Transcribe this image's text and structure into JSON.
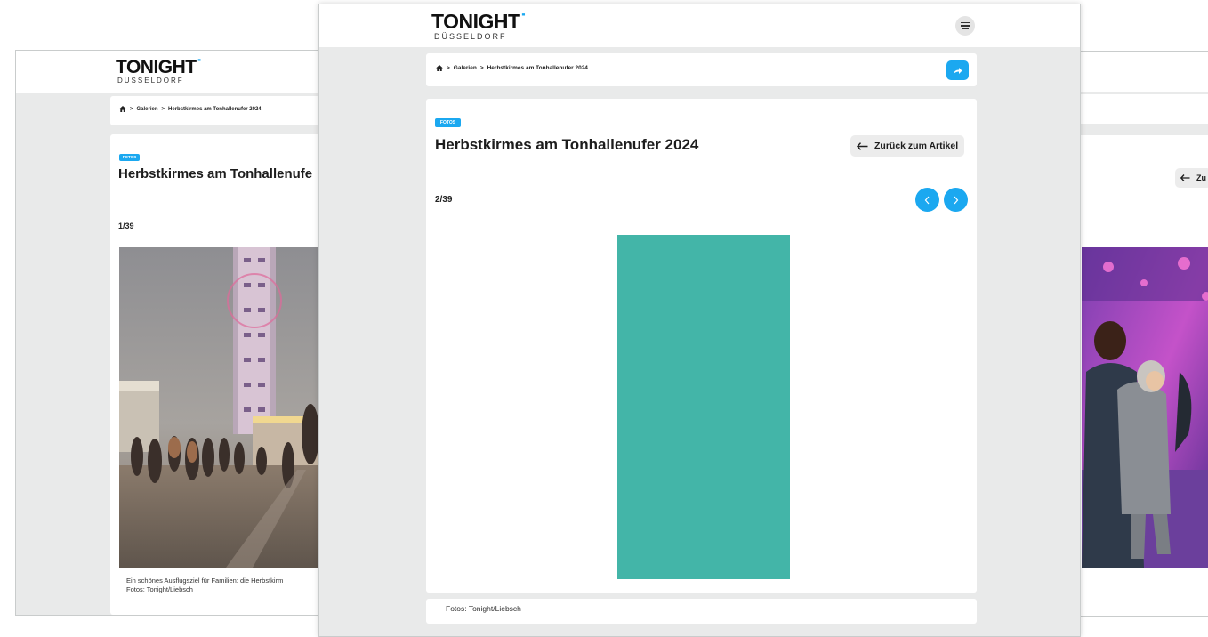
{
  "brand": {
    "name": "TONIGHT",
    "city": "DÜSSELDORF",
    "accent": "#1ba8f0"
  },
  "breadcrumb": {
    "separator": ">",
    "items": [
      "Galerien",
      "Herbstkirmes am Tonhallenufer 2024"
    ]
  },
  "gallery": {
    "badge": "FOTOS",
    "title": "Herbstkirmes am Tonhallenufer 2024",
    "back_label": "Zurück zum Artikel",
    "back_label_partial": "Zu",
    "title_partial": "Herbstkirmes am Tonhallenufe",
    "photo_color": "#43b5a8"
  },
  "slides": {
    "left": {
      "counter": "1/39",
      "caption_line1": "Ein schönes Ausflugsziel für Familien: die Herbstkirm",
      "caption_line2": "Fotos: Tonight/Liebsch"
    },
    "center": {
      "counter": "2/39",
      "caption": "Fotos: Tonight/Liebsch"
    }
  },
  "icons": {
    "home": "home-icon",
    "menu": "hamburger-menu-icon",
    "share": "share-icon",
    "back": "arrow-left-icon",
    "prev": "chevron-left-icon",
    "next": "chevron-right-icon"
  }
}
